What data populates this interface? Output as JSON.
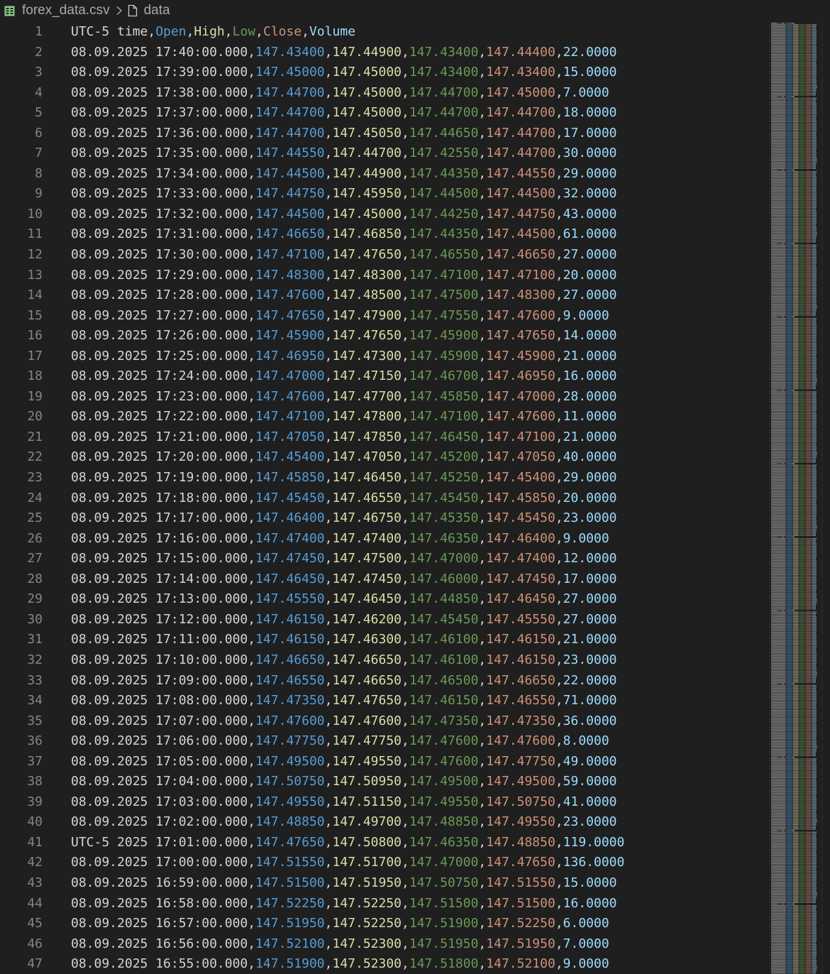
{
  "breadcrumb": {
    "file_name": "forex_data.csv",
    "symbol": "data",
    "icons": [
      "csv-file-icon",
      "chevron-right-icon",
      "file-icon"
    ]
  },
  "colors": {
    "background": "#1f1f1f",
    "line_number": "#858585",
    "columns": [
      "#d4d4d4",
      "#569cd6",
      "#dcdcaa",
      "#6a9955",
      "#ce9178",
      "#9cdcfe"
    ]
  },
  "editor": {
    "header_row": [
      "UTC-5 time",
      "Open",
      "High",
      "Low",
      "Close",
      "Volume"
    ],
    "rows": [
      [
        "08.09.2025 17:40:00.000",
        "147.43400",
        "147.44900",
        "147.43400",
        "147.44400",
        "22.0000"
      ],
      [
        "08.09.2025 17:39:00.000",
        "147.45000",
        "147.45000",
        "147.43400",
        "147.43400",
        "15.0000"
      ],
      [
        "08.09.2025 17:38:00.000",
        "147.44700",
        "147.45000",
        "147.44700",
        "147.45000",
        "7.0000"
      ],
      [
        "08.09.2025 17:37:00.000",
        "147.44700",
        "147.45000",
        "147.44700",
        "147.44700",
        "18.0000"
      ],
      [
        "08.09.2025 17:36:00.000",
        "147.44700",
        "147.45050",
        "147.44650",
        "147.44700",
        "17.0000"
      ],
      [
        "08.09.2025 17:35:00.000",
        "147.44550",
        "147.44700",
        "147.42550",
        "147.44700",
        "30.0000"
      ],
      [
        "08.09.2025 17:34:00.000",
        "147.44500",
        "147.44900",
        "147.44350",
        "147.44550",
        "29.0000"
      ],
      [
        "08.09.2025 17:33:00.000",
        "147.44750",
        "147.45950",
        "147.44500",
        "147.44500",
        "32.0000"
      ],
      [
        "08.09.2025 17:32:00.000",
        "147.44500",
        "147.45000",
        "147.44250",
        "147.44750",
        "43.0000"
      ],
      [
        "08.09.2025 17:31:00.000",
        "147.46650",
        "147.46850",
        "147.44350",
        "147.44500",
        "61.0000"
      ],
      [
        "08.09.2025 17:30:00.000",
        "147.47100",
        "147.47650",
        "147.46550",
        "147.46650",
        "27.0000"
      ],
      [
        "08.09.2025 17:29:00.000",
        "147.48300",
        "147.48300",
        "147.47100",
        "147.47100",
        "20.0000"
      ],
      [
        "08.09.2025 17:28:00.000",
        "147.47600",
        "147.48500",
        "147.47500",
        "147.48300",
        "27.0000"
      ],
      [
        "08.09.2025 17:27:00.000",
        "147.47650",
        "147.47900",
        "147.47550",
        "147.47600",
        "9.0000"
      ],
      [
        "08.09.2025 17:26:00.000",
        "147.45900",
        "147.47650",
        "147.45900",
        "147.47650",
        "14.0000"
      ],
      [
        "08.09.2025 17:25:00.000",
        "147.46950",
        "147.47300",
        "147.45900",
        "147.45900",
        "21.0000"
      ],
      [
        "08.09.2025 17:24:00.000",
        "147.47000",
        "147.47150",
        "147.46700",
        "147.46950",
        "16.0000"
      ],
      [
        "08.09.2025 17:23:00.000",
        "147.47600",
        "147.47700",
        "147.45850",
        "147.47000",
        "28.0000"
      ],
      [
        "08.09.2025 17:22:00.000",
        "147.47100",
        "147.47800",
        "147.47100",
        "147.47600",
        "11.0000"
      ],
      [
        "08.09.2025 17:21:00.000",
        "147.47050",
        "147.47850",
        "147.46450",
        "147.47100",
        "21.0000"
      ],
      [
        "08.09.2025 17:20:00.000",
        "147.45400",
        "147.47050",
        "147.45200",
        "147.47050",
        "40.0000"
      ],
      [
        "08.09.2025 17:19:00.000",
        "147.45850",
        "147.46450",
        "147.45250",
        "147.45400",
        "29.0000"
      ],
      [
        "08.09.2025 17:18:00.000",
        "147.45450",
        "147.46550",
        "147.45450",
        "147.45850",
        "20.0000"
      ],
      [
        "08.09.2025 17:17:00.000",
        "147.46400",
        "147.46750",
        "147.45350",
        "147.45450",
        "23.0000"
      ],
      [
        "08.09.2025 17:16:00.000",
        "147.47400",
        "147.47400",
        "147.46350",
        "147.46400",
        "9.0000"
      ],
      [
        "08.09.2025 17:15:00.000",
        "147.47450",
        "147.47500",
        "147.47000",
        "147.47400",
        "12.0000"
      ],
      [
        "08.09.2025 17:14:00.000",
        "147.46450",
        "147.47450",
        "147.46000",
        "147.47450",
        "17.0000"
      ],
      [
        "08.09.2025 17:13:00.000",
        "147.45550",
        "147.46450",
        "147.44850",
        "147.46450",
        "27.0000"
      ],
      [
        "08.09.2025 17:12:00.000",
        "147.46150",
        "147.46200",
        "147.45450",
        "147.45550",
        "27.0000"
      ],
      [
        "08.09.2025 17:11:00.000",
        "147.46150",
        "147.46300",
        "147.46100",
        "147.46150",
        "21.0000"
      ],
      [
        "08.09.2025 17:10:00.000",
        "147.46650",
        "147.46650",
        "147.46100",
        "147.46150",
        "23.0000"
      ],
      [
        "08.09.2025 17:09:00.000",
        "147.46550",
        "147.46650",
        "147.46500",
        "147.46650",
        "22.0000"
      ],
      [
        "08.09.2025 17:08:00.000",
        "147.47350",
        "147.47650",
        "147.46150",
        "147.46550",
        "71.0000"
      ],
      [
        "08.09.2025 17:07:00.000",
        "147.47600",
        "147.47600",
        "147.47350",
        "147.47350",
        "36.0000"
      ],
      [
        "08.09.2025 17:06:00.000",
        "147.47750",
        "147.47750",
        "147.47600",
        "147.47600",
        "8.0000"
      ],
      [
        "08.09.2025 17:05:00.000",
        "147.49500",
        "147.49550",
        "147.47600",
        "147.47750",
        "49.0000"
      ],
      [
        "08.09.2025 17:04:00.000",
        "147.50750",
        "147.50950",
        "147.49500",
        "147.49500",
        "59.0000"
      ],
      [
        "08.09.2025 17:03:00.000",
        "147.49550",
        "147.51150",
        "147.49550",
        "147.50750",
        "41.0000"
      ],
      [
        "08.09.2025 17:02:00.000",
        "147.48850",
        "147.49700",
        "147.48850",
        "147.49550",
        "23.0000"
      ],
      [
        "UTC-5 2025 17:01:00.000",
        "147.47650",
        "147.50800",
        "147.46350",
        "147.48850",
        "119.0000"
      ],
      [
        "08.09.2025 17:00:00.000",
        "147.51550",
        "147.51700",
        "147.47000",
        "147.47650",
        "136.0000"
      ],
      [
        "08.09.2025 16:59:00.000",
        "147.51500",
        "147.51950",
        "147.50750",
        "147.51550",
        "15.0000"
      ],
      [
        "08.09.2025 16:58:00.000",
        "147.52250",
        "147.52250",
        "147.51500",
        "147.51500",
        "16.0000"
      ],
      [
        "08.09.2025 16:57:00.000",
        "147.51950",
        "147.52250",
        "147.51900",
        "147.52250",
        "6.0000"
      ],
      [
        "08.09.2025 16:56:00.000",
        "147.52100",
        "147.52300",
        "147.51950",
        "147.51950",
        "7.0000"
      ],
      [
        "08.09.2025 16:55:00.000",
        "147.51900",
        "147.52300",
        "147.51800",
        "147.52100",
        "9.0000"
      ]
    ]
  }
}
